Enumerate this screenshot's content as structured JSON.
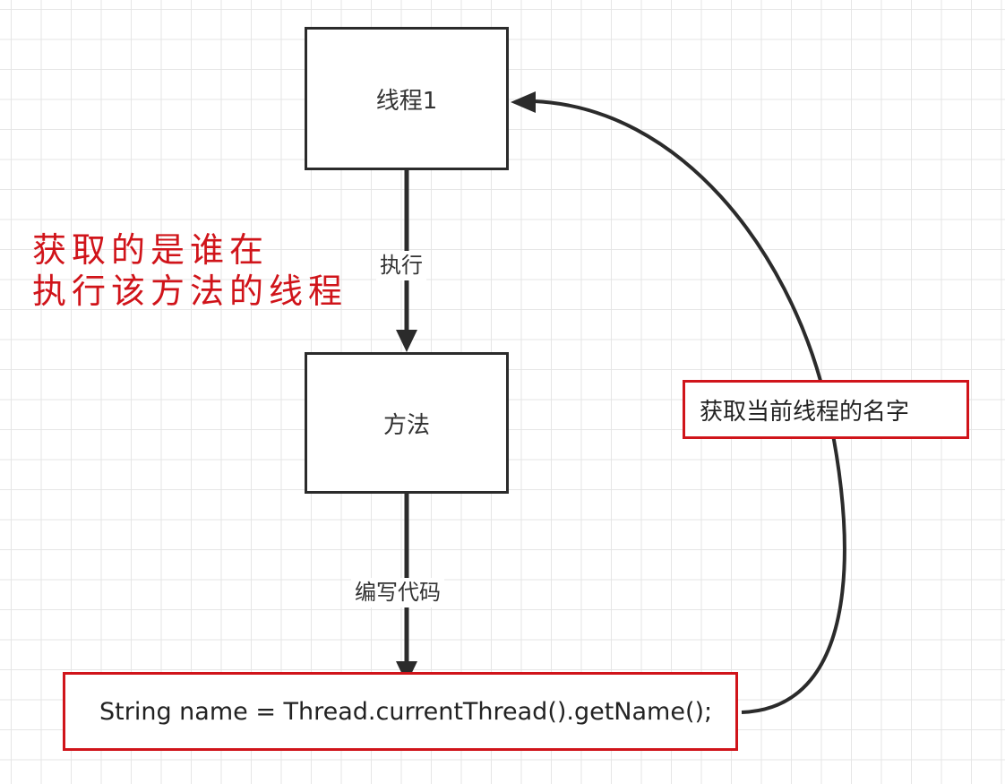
{
  "nodes": {
    "thread": "线程1",
    "method": "方法"
  },
  "edges": {
    "execute": "执行",
    "write_code": "编写代码",
    "get_name": "获取当前线程的名字"
  },
  "code": {
    "line": "String name = Thread.currentThread().getName();"
  },
  "annotation": {
    "line1": "获取的是谁在",
    "line2": "执行该方法的线程"
  },
  "colors": {
    "highlight": "#d0141a",
    "stroke": "#2b2b2b",
    "grid": "#e6e6e6"
  }
}
